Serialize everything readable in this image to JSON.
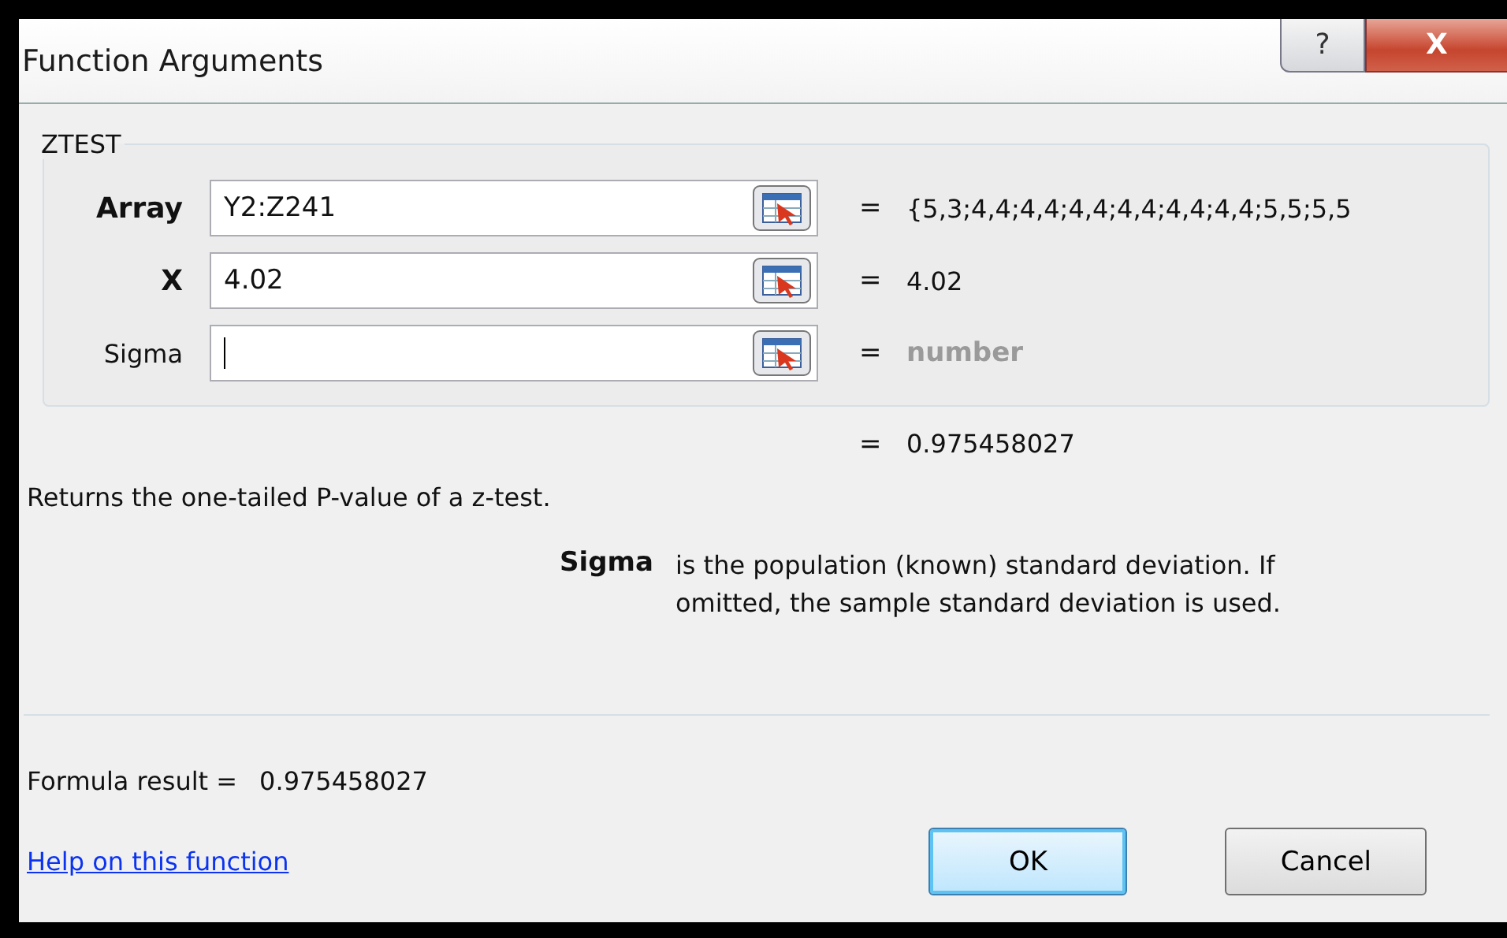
{
  "window": {
    "title": "Function Arguments",
    "help_button": "?",
    "close_button": "X"
  },
  "group": {
    "title": "ZTEST",
    "arguments": [
      {
        "label": "Array",
        "required": true,
        "value": "Y2:Z241",
        "focused": false,
        "result": "{5,3;4,4;4,4;4,4;4,4;4,4;4,4;5,5;5,5",
        "dimmed": false
      },
      {
        "label": "X",
        "required": true,
        "value": "4.02",
        "focused": false,
        "result": "4.02",
        "dimmed": false
      },
      {
        "label": "Sigma",
        "required": false,
        "focused": true,
        "result": "number",
        "dimmed": true
      }
    ]
  },
  "equals_sign": "=",
  "function_result": "0.975458027",
  "description": "Returns the one-tailed P-value of a z-test.",
  "argument_help": {
    "name": "Sigma",
    "text": "is the population (known) standard deviation. If omitted, the sample standard deviation is used."
  },
  "formula_result": {
    "label": "Formula result =",
    "value": "0.975458027"
  },
  "help_link": "Help on this function",
  "buttons": [
    {
      "label": "OK",
      "default": true
    },
    {
      "label": "Cancel",
      "default": false
    }
  ]
}
